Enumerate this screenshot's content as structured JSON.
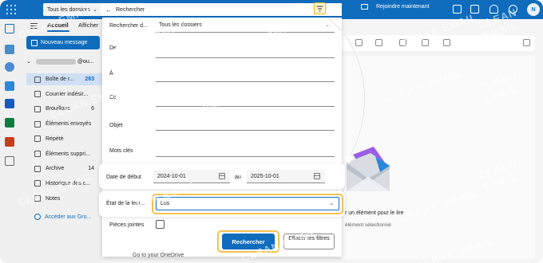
{
  "topbar": {
    "scope_label": "Tous les dossiers",
    "search_text": "Rechercher",
    "join_label": "Rejoindre maintenant",
    "avatar_initial": "N"
  },
  "ribbon": {
    "tab_home": "Accueil",
    "tab_view": "Afficher",
    "new_message": "Nouveau message"
  },
  "nav": {
    "account_suffix": "@ou...",
    "folders": [
      {
        "label": "Boîte de r...",
        "count": "283",
        "icon": "inbox-icon",
        "selected": true
      },
      {
        "label": "Courrier indésir...",
        "count": "",
        "icon": "junk-icon"
      },
      {
        "label": "Brouillons",
        "count": "6",
        "icon": "drafts-icon"
      },
      {
        "label": "Éléments envoyés",
        "count": "",
        "icon": "sent-icon"
      },
      {
        "label": "Répété",
        "count": "",
        "icon": "recurring-icon"
      },
      {
        "label": "Éléments suppri...",
        "count": "",
        "icon": "trash-icon"
      },
      {
        "label": "Archive",
        "count": "14",
        "icon": "archive-icon"
      },
      {
        "label": "Historique des c...",
        "count": "",
        "icon": "folder-icon"
      },
      {
        "label": "Notes",
        "count": "",
        "icon": "notes-icon"
      }
    ],
    "access_groups": "Accéder aux Gro..."
  },
  "search_panel": {
    "search_in_label": "Rechercher d...",
    "search_in_value": "Tous les dossiers",
    "from_label": "De",
    "to_label": "À",
    "cc_label": "Cc",
    "subject_label": "Objet",
    "keywords_label": "Mots clés",
    "start_date_label": "Date de début",
    "start_date_value": "2024-10-01",
    "to_word": "au",
    "end_date_value": "2025-10-01",
    "read_state_label": "État de la lect...",
    "read_state_value": "Lus",
    "attachments_label": "Pièces jointes",
    "search_button": "Rechercher",
    "clear_button": "Effacer les filtres",
    "onedrive_link": "Go to your OneDrive"
  },
  "reading_pane": {
    "line1": "r un élément pour le lire",
    "line2": "élément sélectionné"
  },
  "watermark": "CLEAN EMAIL",
  "colors": {
    "accent": "#0f6cbd",
    "highlight": "#f2c250"
  }
}
